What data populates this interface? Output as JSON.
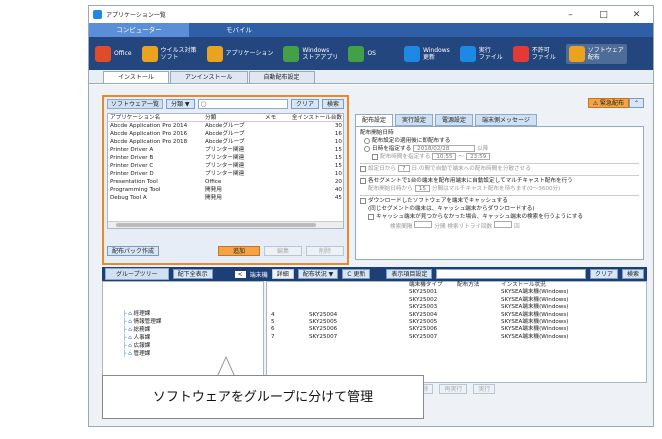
{
  "window": {
    "title": "アプリケーション一覧",
    "minimize": "–",
    "maximize": "□",
    "close": "✕"
  },
  "modes": [
    "コンピューター",
    "モバイル"
  ],
  "ribbon": [
    {
      "label": "Office",
      "icon": "office-icon",
      "color": "#e04b2a"
    },
    {
      "label": "ウイルス対策\nソフト",
      "icon": "antivirus-icon",
      "color": "#e9a31e"
    },
    {
      "label": "アプリケーション",
      "icon": "application-icon",
      "color": "#e9a31e"
    },
    {
      "label": "Windows\nストアアプリ",
      "icon": "store-icon",
      "color": "#43a047"
    },
    {
      "label": "OS",
      "icon": "os-icon",
      "color": "#43a047"
    },
    {
      "label": "Windows\n更新",
      "icon": "windows-update-icon",
      "color": "#1e88e5"
    },
    {
      "label": "実行\nファイル",
      "icon": "exe-icon",
      "color": "#1e88e5"
    },
    {
      "label": "不許可\nファイル",
      "icon": "forbidden-icon",
      "color": "#e53935"
    },
    {
      "label": "ソフトウェア\n配布",
      "icon": "software-dist-icon",
      "color": "#e9a31e"
    }
  ],
  "subtabs": [
    "インストール",
    "アンインストール",
    "自動配布設定"
  ],
  "software": {
    "title": "ソフトウェア一覧",
    "group_btn": "分類 ▼",
    "clear": "クリア",
    "search": "検索",
    "headers": [
      "アプリケーション名",
      "分類",
      "メモ",
      "全インストール台数"
    ],
    "rows": [
      [
        "Abcde Application Pro 2014",
        "Abcdeグループ",
        "",
        "30"
      ],
      [
        "Abcde Application Pro 2016",
        "Abcdeグループ",
        "",
        "16"
      ],
      [
        "Abcde Application Pro 2018",
        "Abcdeグループ",
        "",
        "10"
      ],
      [
        "Printer Driver A",
        "プリンター関連",
        "",
        "15"
      ],
      [
        "Printer Driver B",
        "プリンター関連",
        "",
        "15"
      ],
      [
        "Printer Driver C",
        "プリンター関連",
        "",
        "15"
      ],
      [
        "Printer Driver D",
        "プリンター関連",
        "",
        "10"
      ],
      [
        "Presentation Tool",
        "Office",
        "",
        "20"
      ],
      [
        "Programming Tool",
        "開発用",
        "",
        "40"
      ],
      [
        "Debug Tool A",
        "開発用",
        "",
        "45"
      ]
    ],
    "pack_btn": "配布パック作成",
    "add": "追加",
    "edit": "編集",
    "delete": "削除"
  },
  "dist": {
    "emergency": "緊急配布",
    "tabs": [
      "配布設定",
      "実行設定",
      "電源設定",
      "端末側メッセージ"
    ],
    "start_label": "配布開始日時",
    "opt1": "配布設定の適用後に即配布する",
    "opt2": "日時を指定する",
    "date": "2018/02/28",
    "after": "以降",
    "time_chk": "配布時間を指定する",
    "t_from": "10:55",
    "tilde": "〜",
    "t_to": "23:59",
    "days_chk": "設定日から",
    "days_val": "7",
    "days_unit": "日",
    "days_tail": "の間で自動で端末への配布時間を分散させる",
    "mc_chk": "各セグメントで1台の端末を配布用端末に自動設定してマルチキャスト配布を行う",
    "mc_sub1": "配布開始日時から",
    "mc_val": "15",
    "mc_sub2": "分間はマルチキャスト配布を待ちます(0〜3600分)",
    "cache": "ダウンロードしたソフトウェアを端末でキャッシュする",
    "cache2": "(同じセグメントの端末は、キャッシュ端末からダウンロードする)",
    "cache3": "キャッシュ端末が見つからなかった場合、キャッシュ端末の検索を行うようにする",
    "cache4": "検索間隔",
    "cache5": "分間",
    "cache6": "検索リトライ回数",
    "cache7": "回"
  },
  "groups": {
    "title": "グループツリー",
    "show_all": "配下全表示",
    "nodes": [
      "経理課",
      "情報管理課",
      "総務課",
      "人事課",
      "広報課",
      "管理課"
    ]
  },
  "terminals": {
    "label": "端末機",
    "detail": "詳細",
    "status": "配布状況 ▼",
    "refresh": "C 更新",
    "cols_btn": "表示項目設定",
    "clear": "クリア",
    "search": "検索",
    "headers": [
      "",
      "",
      "端末機タイプ",
      "配布方法",
      "インストール状況"
    ],
    "rows": [
      [
        "",
        "",
        "SKY25001",
        "",
        "SKYSEA端末機(Windows)"
      ],
      [
        "",
        "",
        "SKY25002",
        "",
        "SKYSEA端末機(Windows)"
      ],
      [
        "",
        "",
        "SKY25003",
        "",
        "SKYSEA端末機(Windows)"
      ],
      [
        "4",
        "SKY25004",
        "SKY25004",
        "",
        "SKYSEA端末機(Windows)"
      ],
      [
        "5",
        "SKY25005",
        "SKY25005",
        "",
        "SKYSEA端末機(Windows)"
      ],
      [
        "6",
        "SKY25006",
        "SKY25006",
        "",
        "SKYSEA端末機(Windows)"
      ],
      [
        "7",
        "SKY25007",
        "SKY25007",
        "",
        "SKYSEA端末機(Windows)"
      ]
    ],
    "footer": [
      "設定をエクスポート",
      "設定をインポートして実行",
      "解除",
      "再実行",
      "実行"
    ]
  },
  "callout": "ソフトウェアをグループに分けて管理"
}
